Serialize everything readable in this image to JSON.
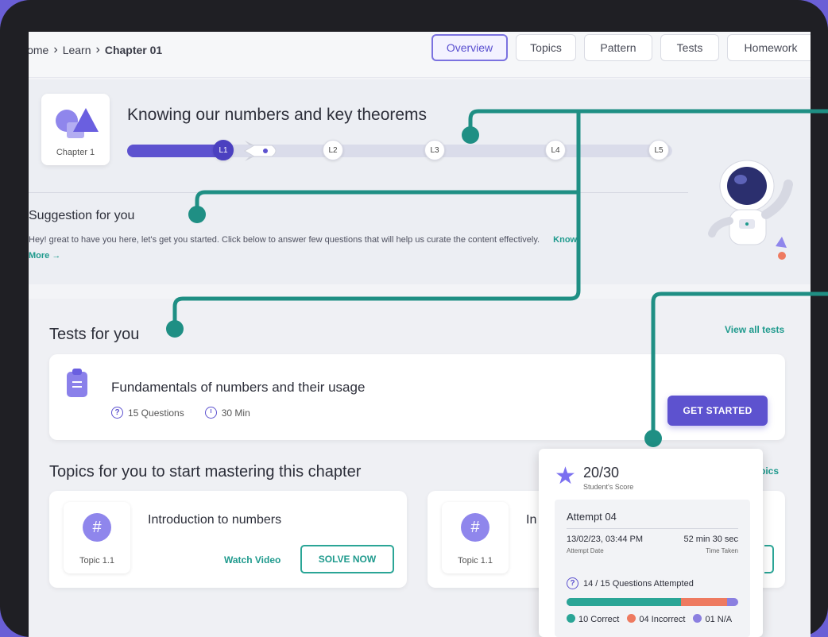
{
  "breadcrumb": {
    "items": [
      "Home",
      "Learn"
    ],
    "current": "Chapter 01"
  },
  "tabs": [
    {
      "label": "Overview",
      "active": true
    },
    {
      "label": "Topics",
      "active": false
    },
    {
      "label": "Pattern",
      "active": false
    },
    {
      "label": "Tests",
      "active": false
    },
    {
      "label": "Homework",
      "active": false
    }
  ],
  "chapter": {
    "label": "Chapter 1",
    "title": "Knowing our numbers and key theorems",
    "levels": [
      "L1",
      "L2",
      "L3",
      "L4",
      "L5"
    ],
    "current_level": "L1",
    "progress_fraction": 0.18
  },
  "suggestion": {
    "title": "Suggestion for you",
    "text": "Hey! great to have you here, let's get you started. Click below to answer few questions that will help us curate the content effectively.",
    "link": "Know More →"
  },
  "tests": {
    "heading": "Tests for you",
    "view_all": "View all tests",
    "card": {
      "title": "Fundamentals of numbers and their usage",
      "questions": "15 Questions",
      "duration": "30 Min",
      "cta": "GET STARTED"
    }
  },
  "topics": {
    "heading": "Topics for you to  start mastering this chapter",
    "view_all_fragment": "pics",
    "cards": [
      {
        "badge": "Topic 1.1",
        "title": "Introduction to numbers",
        "watch": "Watch Video",
        "solve": "SOLVE NOW"
      },
      {
        "badge": "Topic 1.1",
        "title": "In",
        "watch": "",
        "solve": ""
      }
    ]
  },
  "score": {
    "value": "20/30",
    "label": "Student's Score",
    "attempt": {
      "title": "Attempt 04",
      "date": "13/02/23, 03:44 PM",
      "date_label": "Attempt Date",
      "time": "52 min 30 sec",
      "time_label": "Time Taken",
      "questions_attempted": "14 / 15 Questions Attempted",
      "correct": "10 Correct",
      "incorrect": "04 Incorrect",
      "na": "01 N/A",
      "correct_count": 10,
      "incorrect_count": 4,
      "na_count": 1
    }
  },
  "colors": {
    "accent": "#5d52cf",
    "teal": "#1f9a8d",
    "incorrect": "#ee7a60",
    "na": "#8b7fe0",
    "background": "#6a5fd6"
  }
}
